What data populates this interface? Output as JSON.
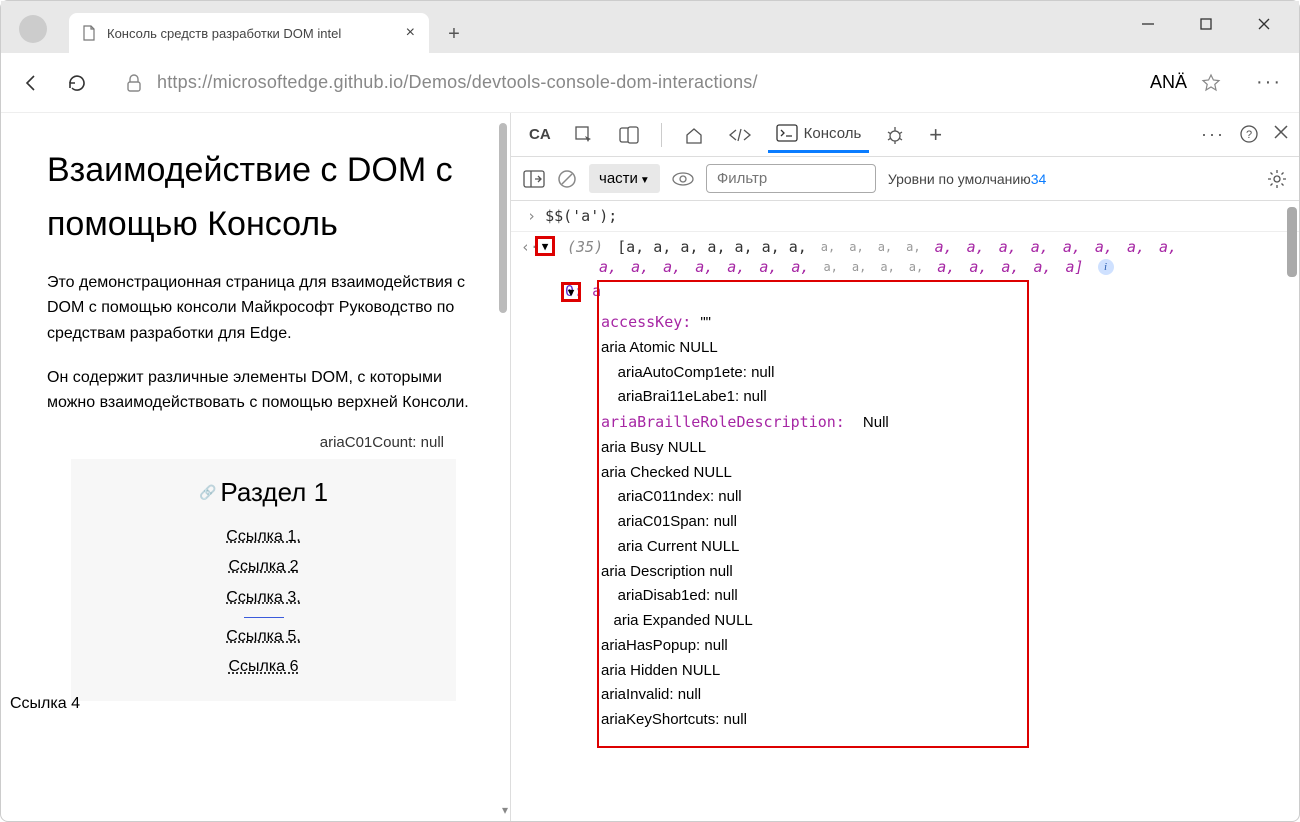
{
  "tab": {
    "title": "Консоль средств разработки DOM intel"
  },
  "url": "https://microsoftedge.github.io/Demos/devtools-console-dom-interactions/",
  "addr_right": "ANÄ",
  "page": {
    "h1": "Взаимодействие с DOM с помощью Консоль",
    "p1": "Это демонстрационная страница для взаимодействия с DOM с помощью консоли Майкрософт Руководство по средствам разработки для Edge.",
    "p2": "Он содержит различные элементы DOM, с которыми можно взаимодействовать с помощью верхней Консоли.",
    "aria_count": "ariaC01Count: null",
    "section_title": "Раздел 1",
    "links": [
      "Ссылка 1.",
      "Ссылка 2",
      "Ссылка 3.",
      "Ссылка 5.",
      "Ссылка 6"
    ],
    "float_link": "Ссылка 4"
  },
  "devtools": {
    "tabs": {
      "ca": "CA",
      "console": "Консоль"
    },
    "filter_toggle": "части",
    "filter_placeholder": "Фильтр",
    "levels": "Уровни по умолчанию",
    "badge": "34",
    "cmd": "$$('a');",
    "count": "(35)",
    "array_head": "[a, a, a, a, a, a, a,",
    "expand_index": "0:",
    "expand_tag": "a",
    "props_block": [
      {
        "k": "accessKey: ",
        "v": "\"\"",
        "mono": true
      },
      {
        "t": "aria Atomic NULL"
      },
      {
        "t": "    ariaAutoComp1ete: null"
      },
      {
        "t": "    ariaBrai11eLabe1: null"
      },
      {
        "k": "ariaBrailleRoleDescription:  ",
        "v": "Null",
        "mono": true
      },
      {
        "t": "aria Busy NULL"
      },
      {
        "t": "aria Checked NULL"
      },
      {
        "t": ""
      },
      {
        "t": "    ariaC011ndex: null"
      },
      {
        "t": "    ariaC01Span: null"
      },
      {
        "t": "    aria Current NULL"
      },
      {
        "t": "aria Description null"
      },
      {
        "t": "    ariaDisab1ed: null"
      },
      {
        "t": "   aria Expanded NULL"
      },
      {
        "t": "ariaHasPopup: null"
      },
      {
        "t": "aria Hidden NULL"
      },
      {
        "t": "ariaInvalid: null"
      },
      {
        "t": "ariaKeyShortcuts: null"
      }
    ]
  }
}
